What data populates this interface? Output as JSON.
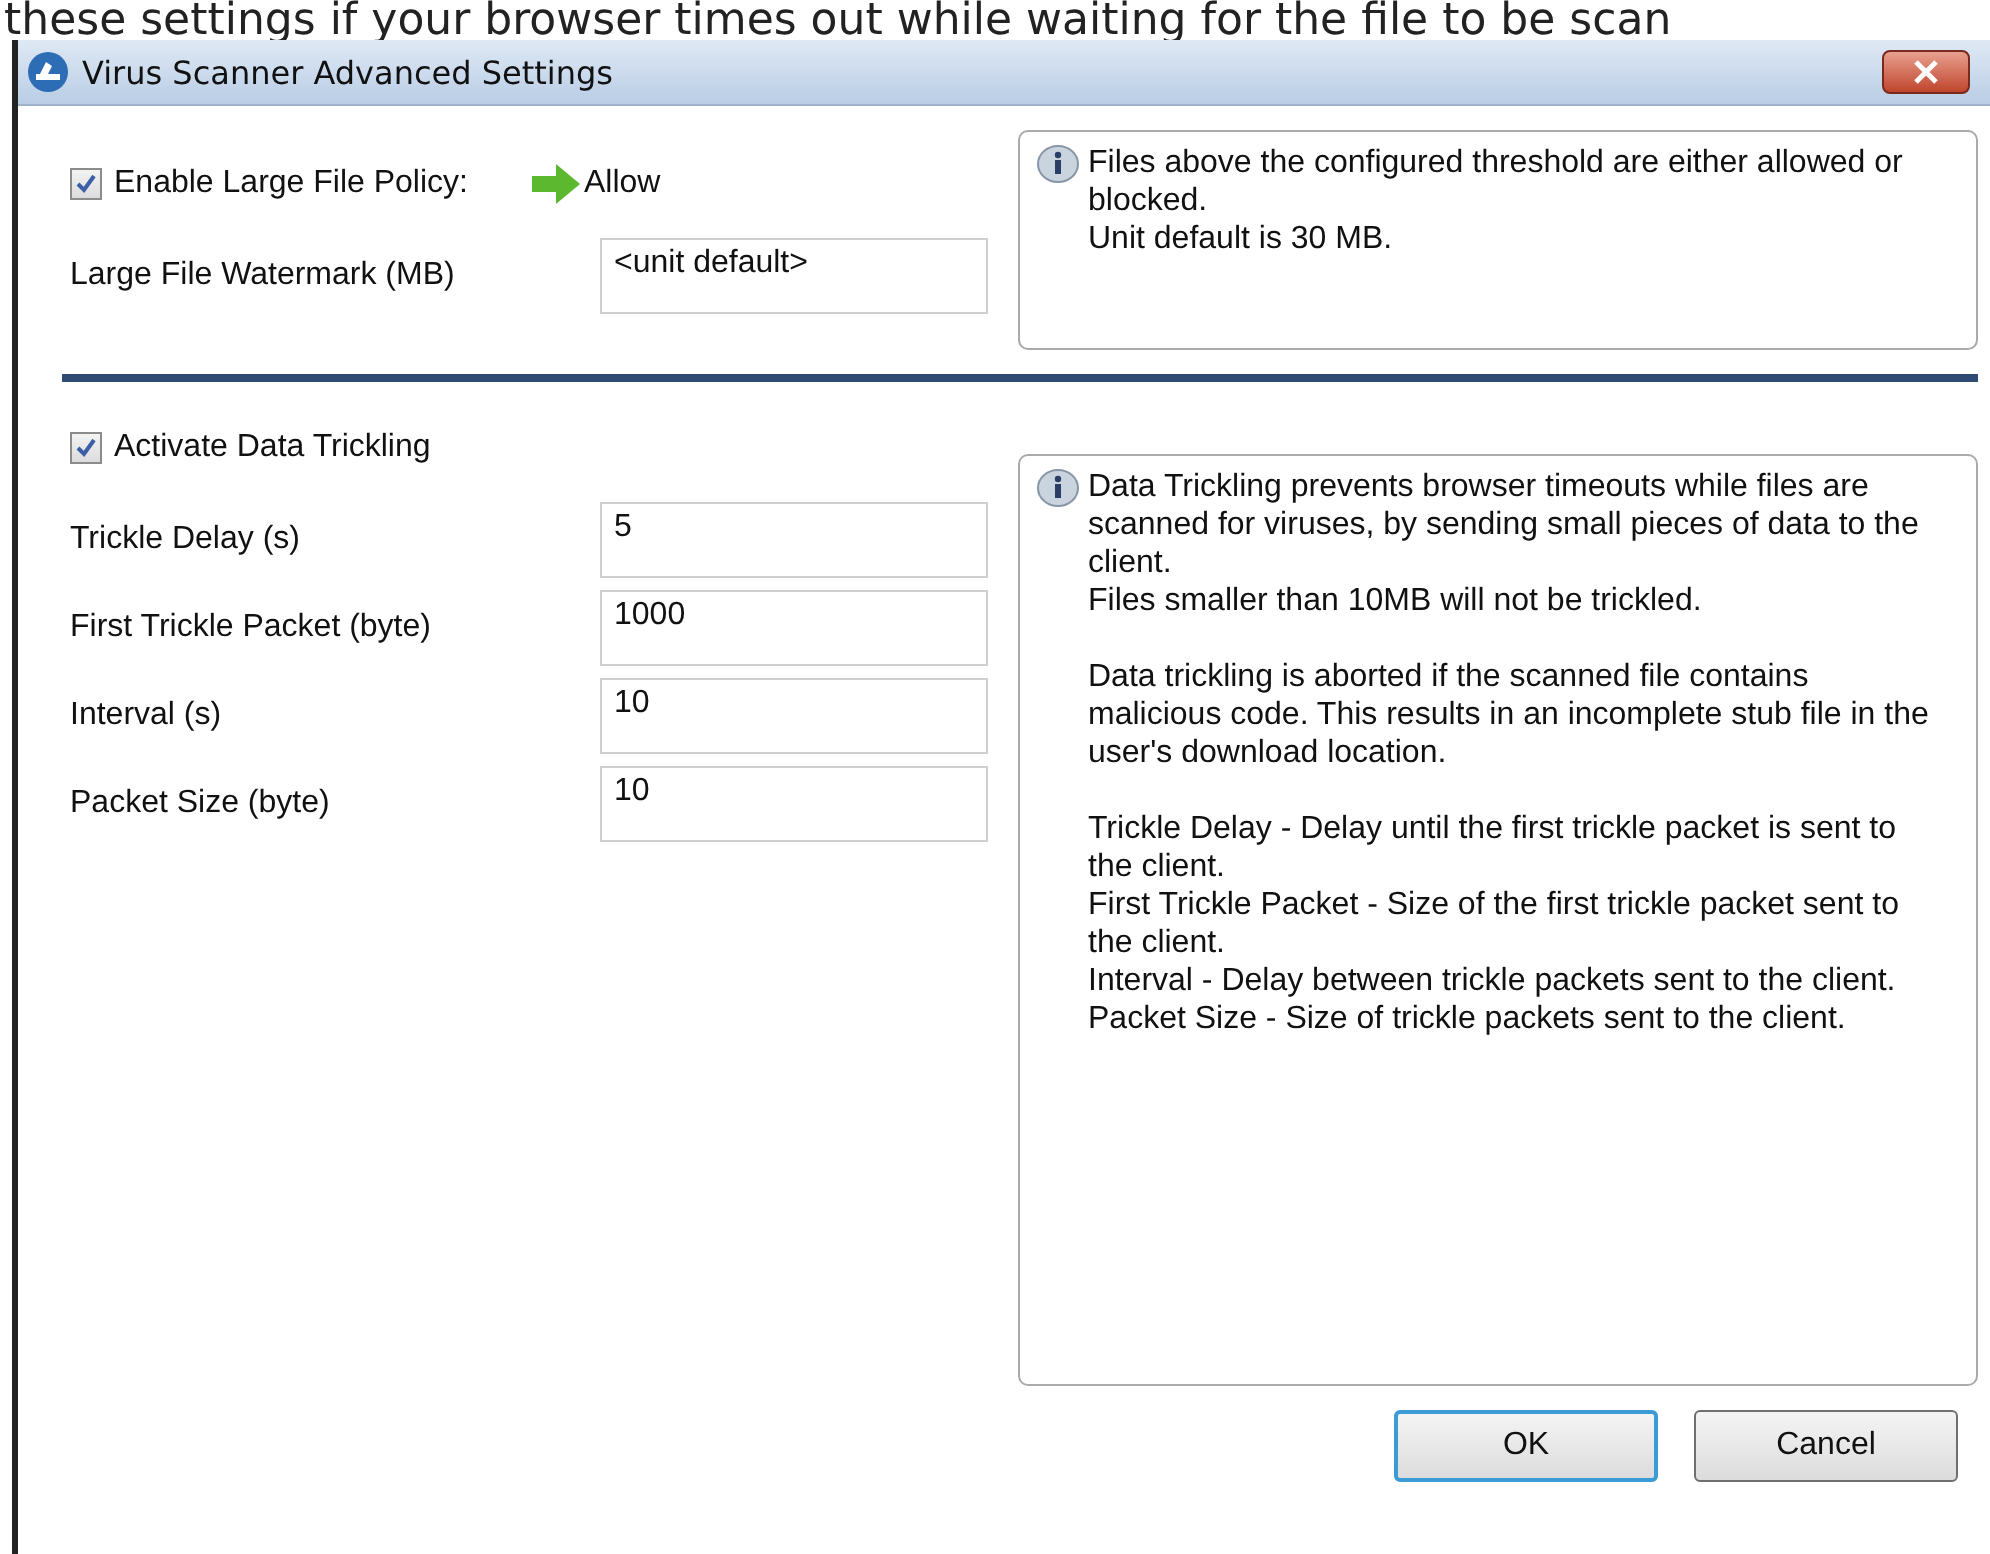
{
  "page_text": "these settings if your browser times out while waiting for the file to be scan",
  "window": {
    "title": "Virus Scanner Advanced Settings"
  },
  "large_file": {
    "checkbox": {
      "label": "Enable Large File Policy:",
      "checked": true
    },
    "action": "Allow",
    "fields": [
      {
        "label": "Large File Watermark (MB)",
        "value": "<unit default>"
      }
    ],
    "info": [
      [
        "Files above the configured threshold are either allowed or blocked.",
        "Unit default is 30 MB."
      ]
    ]
  },
  "trickling": {
    "checkbox": {
      "label": "Activate Data Trickling",
      "checked": true
    },
    "fields": [
      {
        "label": "Trickle Delay (s)",
        "value": "5"
      },
      {
        "label": "First Trickle Packet (byte)",
        "value": "1000"
      },
      {
        "label": "Interval (s)",
        "value": "10"
      },
      {
        "label": "Packet Size (byte)",
        "value": "10"
      }
    ],
    "info": [
      [
        "Data Trickling prevents browser timeouts while files are scanned for viruses, by sending small pieces of data to the client.",
        "Files smaller than 10MB will not be trickled."
      ],
      [
        "Data trickling is aborted if the scanned file contains malicious code. This results in an incomplete stub file in the user's download location."
      ],
      [
        "Trickle Delay - Delay until the first trickle packet is sent to the client.",
        "First Trickle Packet - Size of the first trickle packet sent to the client.",
        "Interval - Delay between trickle packets sent to the client.",
        "Packet Size - Size of trickle packets sent to the client."
      ]
    ]
  },
  "buttons": [
    {
      "label": "OK",
      "default": true
    },
    {
      "label": "Cancel",
      "default": false
    }
  ]
}
